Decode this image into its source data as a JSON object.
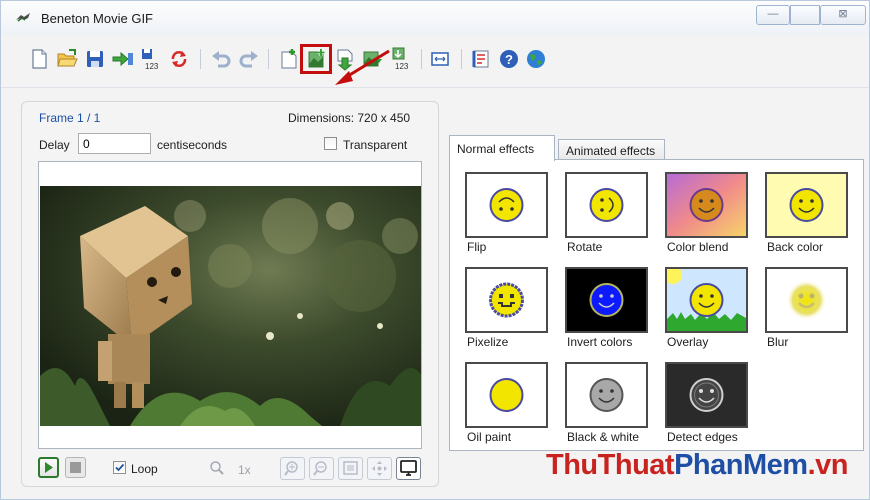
{
  "window": {
    "title": "Beneton Movie GIF",
    "min_glyph": "—",
    "max_glyph": "",
    "close_glyph": "⊠"
  },
  "toolbar": {
    "buttons": [
      {
        "name": "new-icon"
      },
      {
        "name": "open-icon"
      },
      {
        "name": "save-icon"
      },
      {
        "name": "export-icon"
      },
      {
        "name": "save-numbered-icon",
        "text": "123"
      },
      {
        "name": "convert-icon"
      },
      {
        "name": "undo-icon"
      },
      {
        "name": "redo-icon"
      },
      {
        "name": "insert-frame-icon"
      },
      {
        "name": "insert-image-icon"
      },
      {
        "name": "import-down-icon"
      },
      {
        "name": "import-picture-icon"
      },
      {
        "name": "import-numbered-icon",
        "text": "123"
      },
      {
        "name": "resize-icon"
      },
      {
        "name": "properties-icon"
      },
      {
        "name": "help-icon"
      },
      {
        "name": "web-icon"
      }
    ],
    "highlighted": "insert-image-icon"
  },
  "frame_panel": {
    "frame_label": "Frame 1 / 1",
    "dimensions_label": "Dimensions: 720 x 450",
    "delay_label": "Delay",
    "delay_value": "0",
    "delay_unit": "centiseconds",
    "transparent_label": "Transparent",
    "transparent_checked": false,
    "loop_label": "Loop",
    "loop_checked": true,
    "zoom_label": "1x"
  },
  "tabs": [
    {
      "label": "Normal effects",
      "active": true
    },
    {
      "label": "Animated effects",
      "active": false
    }
  ],
  "effects": [
    {
      "label": "Flip"
    },
    {
      "label": "Rotate"
    },
    {
      "label": "Color blend"
    },
    {
      "label": "Back color"
    },
    {
      "label": "Pixelize"
    },
    {
      "label": "Invert colors"
    },
    {
      "label": "Overlay"
    },
    {
      "label": "Blur"
    },
    {
      "label": "Oil paint"
    },
    {
      "label": "Black & white"
    },
    {
      "label": "Detect edges"
    }
  ],
  "watermark": {
    "part1": "ThuThuat",
    "part2": "PhanMem",
    "part3": ".vn"
  },
  "colors": {
    "accent_red": "#c40d0d",
    "frame_label": "#1b4fa8",
    "smiley_yellow": "#f2e600"
  }
}
